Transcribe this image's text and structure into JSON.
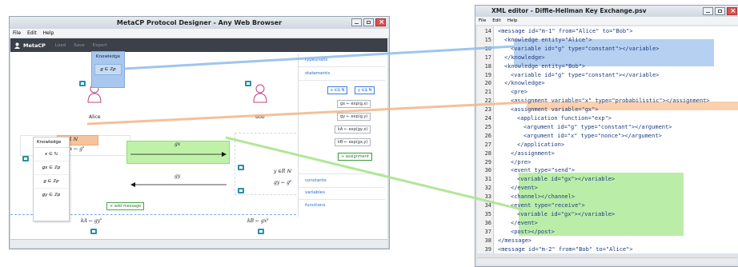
{
  "left_window": {
    "title": "MetaCP Protocol Designer - Any Web Browser",
    "menu": [
      "File",
      "Edit",
      "Help"
    ],
    "app": {
      "brand": "MetaCP",
      "toolbar": [
        "Load",
        "Save",
        "Export"
      ]
    },
    "principals": {
      "alice": "Alice",
      "bob": "Bob"
    },
    "knowledge_popup": {
      "header": "Knowledge",
      "item": "g ∈ ℤp"
    },
    "statements_panel": {
      "types_sets": "types/sets",
      "statements": "statements",
      "buttons": [
        "x ∈$ N",
        "y ∈$ N",
        "gx ← exp(g,x)",
        "gy ← exp(g,y)",
        "kA ← exp(gy,x)",
        "kB ← exp(gx,y)",
        "+ assignment"
      ],
      "constants": "constants",
      "variables": "variables",
      "functions": "functions"
    },
    "knowledge_list": {
      "header": "Knowledge",
      "items": [
        "x ∈ ℕ",
        "gx ∈ ℤp",
        "g ∈ ℤp",
        "gy ∈ ℤp"
      ]
    },
    "math": {
      "alice_rand": "x ∈R ℕ",
      "alice_exp": "gx ← g",
      "alice_exp_sup": "x",
      "msg1": "gx",
      "msg2": "gy",
      "bob_rand": "y ∈R ℕ",
      "bob_exp": "gy ← g",
      "bob_exp_sup": "y",
      "ka": "kA ← gy",
      "ka_sup": "x",
      "kb": "kB ← gx",
      "kb_sup": "y"
    },
    "add_message": "+ add message"
  },
  "right_window": {
    "title": "XML editor - Diffie-Hellman Key Exchange.psv",
    "menu": [
      "File",
      "Edit",
      "Help"
    ],
    "lines": [
      {
        "n": "14",
        "code": "<message id=\"m-1\" from=\"Alice\" to=\"Bob\">",
        "indent": 1
      },
      {
        "n": "15",
        "code": "<knowledge entity=\"Alice\">",
        "indent": 2
      },
      {
        "n": "16",
        "code": "<variable id=\"g\" type=\"constant\"></variable>",
        "indent": 3
      },
      {
        "n": "17",
        "code": "</knowledge>",
        "indent": 2
      },
      {
        "n": "18",
        "code": "<knowledge entity=\"Bob\">",
        "indent": 2
      },
      {
        "n": "19",
        "code": "<variable id=\"g\" type=\"constant\"></variable>",
        "indent": 3
      },
      {
        "n": "20",
        "code": "</knowledge>",
        "indent": 2
      },
      {
        "n": "21",
        "code": "<pre>",
        "indent": 3
      },
      {
        "n": "22",
        "code": "<assignment variable=\"x\" type=\"probabilistic\"></assignment>",
        "indent": 3
      },
      {
        "n": "23",
        "code": "<assignment variable=\"gx\">",
        "indent": 3
      },
      {
        "n": "24",
        "code": "<application function=\"exp\">",
        "indent": 4
      },
      {
        "n": "25",
        "code": "<argument id=\"g\" type=\"constant\"></argument>",
        "indent": 5
      },
      {
        "n": "26",
        "code": "<argument id=\"x\" type=\"nonce\"></argument>",
        "indent": 5
      },
      {
        "n": "27",
        "code": "</application>",
        "indent": 4
      },
      {
        "n": "28",
        "code": "</assignment>",
        "indent": 3
      },
      {
        "n": "29",
        "code": "</pre>",
        "indent": 3
      },
      {
        "n": "30",
        "code": "<event type=\"send\">",
        "indent": 3
      },
      {
        "n": "31",
        "code": "<variable id=\"gx\"></variable>",
        "indent": 4
      },
      {
        "n": "32",
        "code": "</event>",
        "indent": 3
      },
      {
        "n": "33",
        "code": "<channel></channel>",
        "indent": 3
      },
      {
        "n": "34",
        "code": "<event type=\"receive\">",
        "indent": 3
      },
      {
        "n": "35",
        "code": "<variable id=\"gx\"></variable>",
        "indent": 4
      },
      {
        "n": "36",
        "code": "</event>",
        "indent": 3
      },
      {
        "n": "37",
        "code": "<post></post>",
        "indent": 3
      },
      {
        "n": "38",
        "code": "</message>",
        "indent": 1
      },
      {
        "n": "39",
        "code": "<message id=\"m-2\" from=\"Bob\" to=\"Alice\">",
        "indent": 1
      }
    ]
  },
  "colors": {
    "link_blue": "#7fb0e6",
    "link_orange": "#f1b487",
    "link_green": "#9fe27f",
    "toolbar_dark": "#3c4048"
  }
}
